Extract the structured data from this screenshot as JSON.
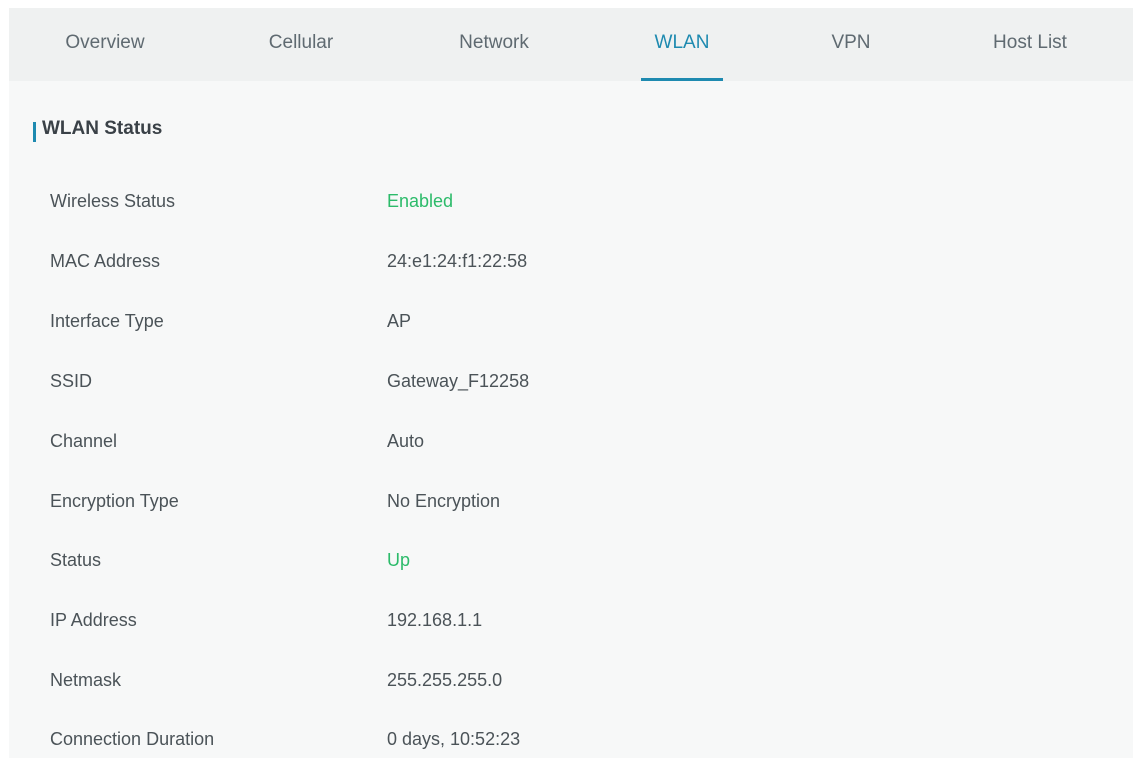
{
  "tabs": [
    {
      "label": "Overview",
      "active": false
    },
    {
      "label": "Cellular",
      "active": false
    },
    {
      "label": "Network",
      "active": false
    },
    {
      "label": "WLAN",
      "active": true
    },
    {
      "label": "VPN",
      "active": false
    },
    {
      "label": "Host List",
      "active": false
    }
  ],
  "section": {
    "title": "WLAN Status"
  },
  "rows": [
    {
      "label": "Wireless Status",
      "value": "Enabled",
      "status_color": "#2cbb6a"
    },
    {
      "label": "MAC Address",
      "value": "24:e1:24:f1:22:58"
    },
    {
      "label": "Interface Type",
      "value": "AP"
    },
    {
      "label": "SSID",
      "value": "Gateway_F12258"
    },
    {
      "label": "Channel",
      "value": "Auto"
    },
    {
      "label": "Encryption Type",
      "value": "No Encryption"
    },
    {
      "label": "Status",
      "value": "Up",
      "status_color": "#2cbb6a"
    },
    {
      "label": "IP Address",
      "value": "192.168.1.1"
    },
    {
      "label": "Netmask",
      "value": "255.255.255.0"
    },
    {
      "label": "Connection Duration",
      "value": "0 days, 10:52:23"
    }
  ],
  "colors": {
    "accent": "#1e8ab0",
    "status_ok": "#2cbb6a",
    "text": "#4b5358",
    "background": "#f7f8f8"
  }
}
